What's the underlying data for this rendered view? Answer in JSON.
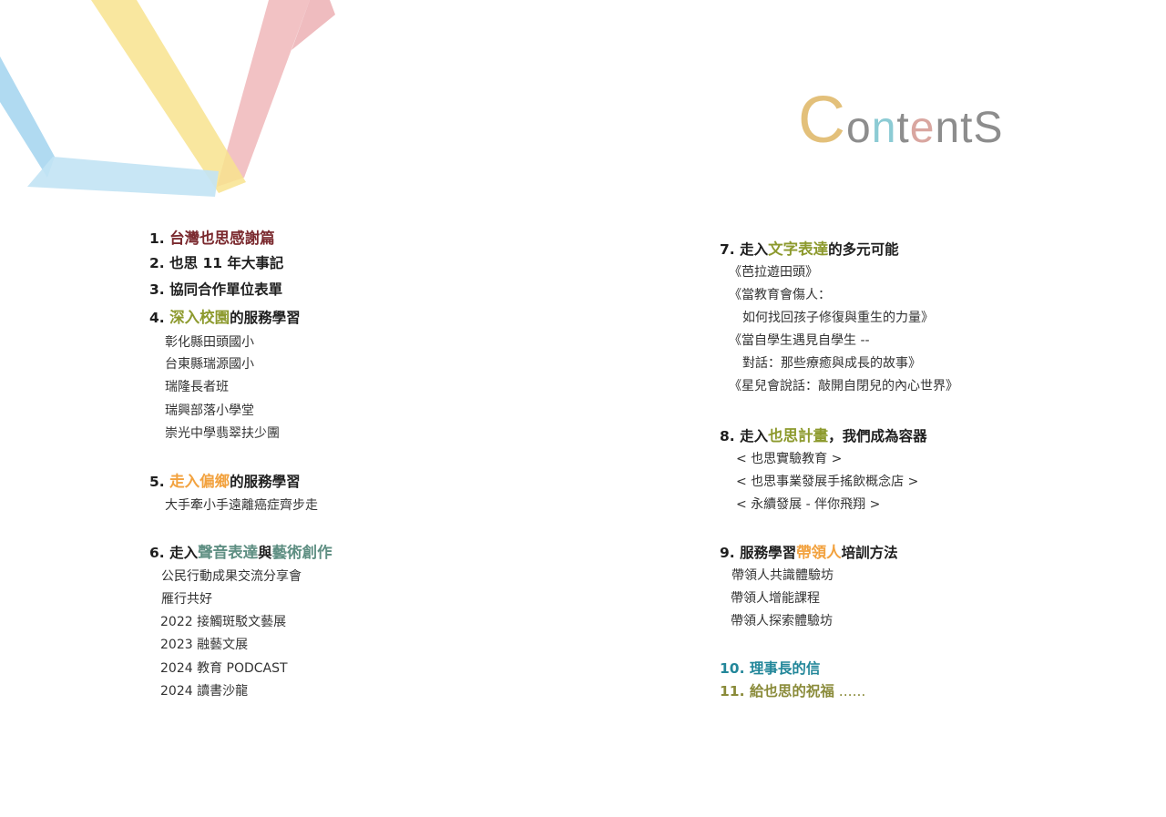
{
  "colors": {
    "maroon": "#7b2a2f",
    "olive": "#8d9a2e",
    "orange": "#f2a23f",
    "teal": "#5f8f83",
    "cyan": "#23879a",
    "olive_dark": "#8a8b3a",
    "title_c": "#e3c07a",
    "title_o": "#8d8d8d",
    "title_n": "#8ccbd4",
    "title_t": "#8d8d8d",
    "title_e": "#d9a6a0",
    "title_n2": "#8d8d8d",
    "title_t2": "#8d8d8d",
    "title_s": "#8d8d8d"
  },
  "title": {
    "c": "C",
    "o": "o",
    "n": "n",
    "t": "t",
    "e": "e",
    "n2": "n",
    "t2": "t",
    "s": "S"
  },
  "left": {
    "s1": {
      "num": "1. ",
      "hl": "台灣也思感謝篇"
    },
    "s2": {
      "text": "2. 也思 11 年大事記"
    },
    "s3": {
      "text": "3. 協同合作單位表單"
    },
    "s4": {
      "num": "4. ",
      "hl": "深入校園",
      "rest": "的服務學習",
      "items": [
        "彰化縣田頭國小",
        "台東縣瑞源國小",
        "瑞隆長者班",
        "瑞興部落小學堂",
        "崇光中學翡翠扶少團"
      ]
    },
    "s5": {
      "num": "5. ",
      "hl": "走入偏鄉",
      "rest": "的服務學習",
      "items": [
        "大手牽小手遠離癌症齊步走"
      ]
    },
    "s6": {
      "num": "6. 走入",
      "hl1": "聲音表達",
      "mid": "與",
      "hl2": "藝術創作",
      "items": [
        "公民行動成果交流分享會",
        "雁行共好",
        "2022 接觸斑駁文藝展",
        "2023 融藝文展",
        "2024 教育 PODCAST",
        "2024 讀書沙龍"
      ]
    }
  },
  "right": {
    "s7": {
      "num": "7. 走入",
      "hl": "文字表達",
      "rest": "的多元可能",
      "items": [
        "《芭拉遊田頭》",
        "《當教育會傷人：",
        "如何找回孩子修復與重生的力量》",
        "《當自學生遇見自學生 --",
        "對話：那些療癒與成長的故事》",
        "《星兒會說話：敲開自閉兒的內心世界》"
      ]
    },
    "s8": {
      "num": "8. 走入",
      "hl": "也思計畫",
      "rest": "，我們成為容器",
      "items": [
        "< 也思實驗教育 >",
        "< 也思事業發展手搖飲概念店 >",
        "< 永續發展 - 伴你飛翔 >"
      ]
    },
    "s9": {
      "num": "9. 服務學習",
      "hl": "帶領人",
      "rest": "培訓方法",
      "items": [
        "帶領人共識體驗坊",
        "帶領人增能課程",
        "帶領人探索體驗坊"
      ]
    },
    "s10": {
      "text": "10. 理事長的信"
    },
    "s11": {
      "text": "11.  給也思的祝福",
      "dots": " ......"
    }
  }
}
